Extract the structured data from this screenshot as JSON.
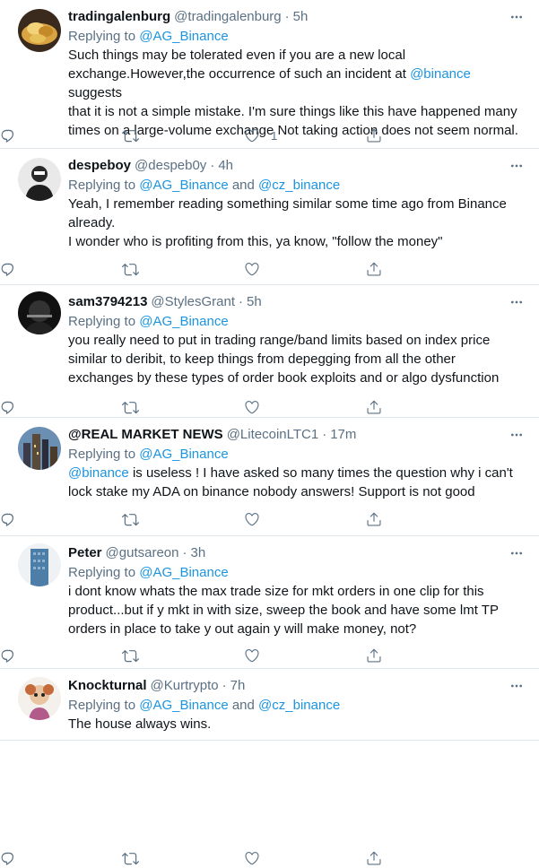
{
  "tweets": [
    {
      "name": "tradingalenburg",
      "handle": "@tradingalenburg",
      "time": "5h",
      "replying_prefix": "Replying to ",
      "mentions": [
        "@AG_Binance"
      ],
      "text_parts": [
        {
          "t": "Such things may be tolerated even if you are a new local\nexchange.However,the occurrence of such an incident at ",
          "link": false
        },
        {
          "t": "@binance",
          "link": true
        },
        {
          "t": " suggests\nthat it is not a simple mistake. I'm sure things like this have happened many\ntimes on a large-volume exchange Not taking action does not seem normal.",
          "link": false
        }
      ],
      "like_count": "1",
      "avatar": "coins"
    },
    {
      "name": "despeboy",
      "handle": "@despeb0y",
      "time": "4h",
      "replying_prefix": "Replying to ",
      "mentions": [
        "@AG_Binance",
        "@cz_binance"
      ],
      "and": " and ",
      "text_parts": [
        {
          "t": "Yeah, I remember reading something similar some time ago from Binance\nalready.\nI wonder who is profiting from this, ya know, \"follow the money\"",
          "link": false
        }
      ],
      "like_count": "",
      "avatar": "person"
    },
    {
      "name": "sam3794213",
      "handle": "@StylesGrant",
      "time": "5h",
      "replying_prefix": "Replying to ",
      "mentions": [
        "@AG_Binance"
      ],
      "text_parts": [
        {
          "t": "you really need to put in trading range/band limits based on index price\nsimilar to deribit, to keep things from depegging from all the other\nexchanges by these types of order book exploits and or algo dysfunction",
          "link": false
        }
      ],
      "like_count": "",
      "avatar": "dark"
    },
    {
      "name": "@REAL MARKET NEWS",
      "handle": "@LitecoinLTC1",
      "time": "17m",
      "replying_prefix": "Replying to ",
      "mentions": [
        "@AG_Binance"
      ],
      "text_parts": [
        {
          "t": "@binance",
          "link": true
        },
        {
          "t": " is useless ! I have asked so many times the question why i can't\nlock stake my ADA on binance nobody answers! Support is not good",
          "link": false
        }
      ],
      "like_count": "",
      "avatar": "city"
    },
    {
      "name": "Peter",
      "handle": "@gutsareon",
      "time": "3h",
      "replying_prefix": "Replying to ",
      "mentions": [
        "@AG_Binance"
      ],
      "text_parts": [
        {
          "t": "i dont know whats the max trade size for mkt orders in one clip for this\nproduct...but if y mkt in with size, sweep the book and have some lmt TP\norders in place to take y out again y will make money, not?",
          "link": false
        }
      ],
      "like_count": "",
      "avatar": "building"
    },
    {
      "name": "Knockturnal",
      "handle": "@Kurtrypto",
      "time": "7h",
      "replying_prefix": "Replying to ",
      "mentions": [
        "@AG_Binance",
        "@cz_binance"
      ],
      "and": " and ",
      "text_parts": [
        {
          "t": "The house always wins.",
          "link": false
        }
      ],
      "like_count": "",
      "avatar": "doll"
    }
  ],
  "separator": "·",
  "colors": {
    "link": "#1b95e0",
    "muted": "#5b7083",
    "text": "#0f1419",
    "border": "#e1e8ed"
  }
}
